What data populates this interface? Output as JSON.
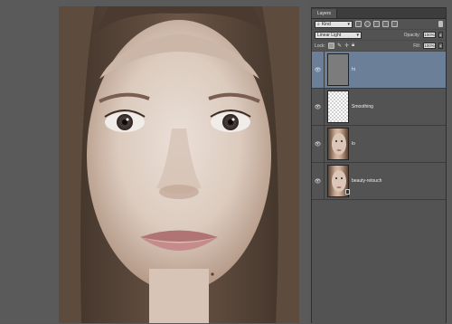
{
  "panel": {
    "tab_label": "Layers",
    "filter_kind": "Kind",
    "blend_mode": "Linear Light",
    "opacity_label": "Opacity:",
    "opacity_value": "100%",
    "lock_label": "Lock:",
    "fill_label": "Fill:",
    "fill_value": "100%"
  },
  "layers": [
    {
      "name": "hi",
      "thumbnail": "gray",
      "visible": true,
      "selected": true
    },
    {
      "name": "Smoothing",
      "thumbnail": "transparent",
      "visible": true,
      "selected": false
    },
    {
      "name": "lo",
      "thumbnail": "face",
      "visible": true,
      "selected": false
    },
    {
      "name": "beauty-retouch",
      "thumbnail": "face",
      "visible": true,
      "selected": false,
      "has_smart_badge": true
    }
  ],
  "icons": {
    "eye": "eye-icon",
    "lock_transparent": "lock-transparent-icon",
    "lock_paint": "brush-icon",
    "lock_move": "move-icon",
    "lock_all": "lock-icon"
  }
}
